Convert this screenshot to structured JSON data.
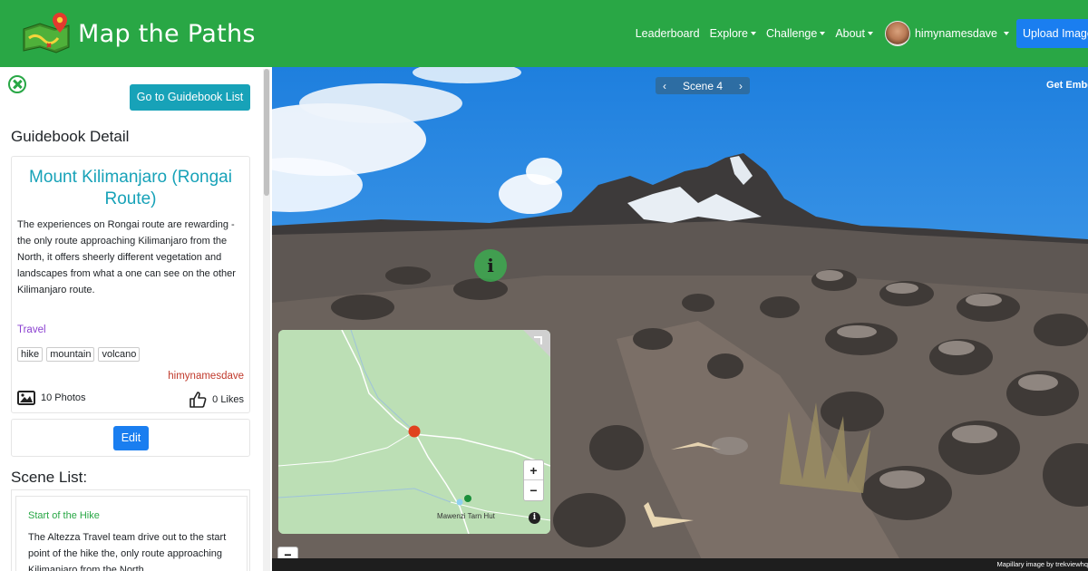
{
  "navbar": {
    "title": "Map the Paths",
    "links": [
      "Leaderboard",
      "Explore",
      "Challenge",
      "About"
    ],
    "username": "himynamesdave",
    "upload_label": "Upload Image"
  },
  "sidebar": {
    "guidebook_list_button": "Go to Guidebook List",
    "detail_heading": "Guidebook Detail",
    "guidebook": {
      "title": "Mount Kilimanjaro (Rongai Route)",
      "description": "The experiences on Rongai route are rewarding - the only route approaching Kilimanjaro from the North, it offers sheerly different vegetation and landscapes from what a one can see on the other Kilimanjaro route.",
      "category": "Travel",
      "tags": [
        "hike",
        "mountain",
        "volcano"
      ],
      "author": "himynamesdave",
      "photos": "10 Photos",
      "likes": "0 Likes"
    },
    "edit_button": "Edit",
    "scene_list_heading": "Scene List:",
    "scenes": [
      {
        "title": "Start of the Hike",
        "description": "The Altezza Travel team drive out to the start point of the hike the, only route approaching Kilimanjaro from the North"
      }
    ]
  },
  "viewer": {
    "scene_label": "Scene 4",
    "embed_label": "Get Embed",
    "map_label": "Mawenzi Tarn Hut",
    "credit": "Mapillary  image by trekviewhq"
  },
  "colors": {
    "brand_green": "#29a745",
    "teal": "#17a2b8",
    "primary_blue": "#1a7ef0",
    "category_purple": "#8a3fd0",
    "author_red": "#c0392b"
  }
}
